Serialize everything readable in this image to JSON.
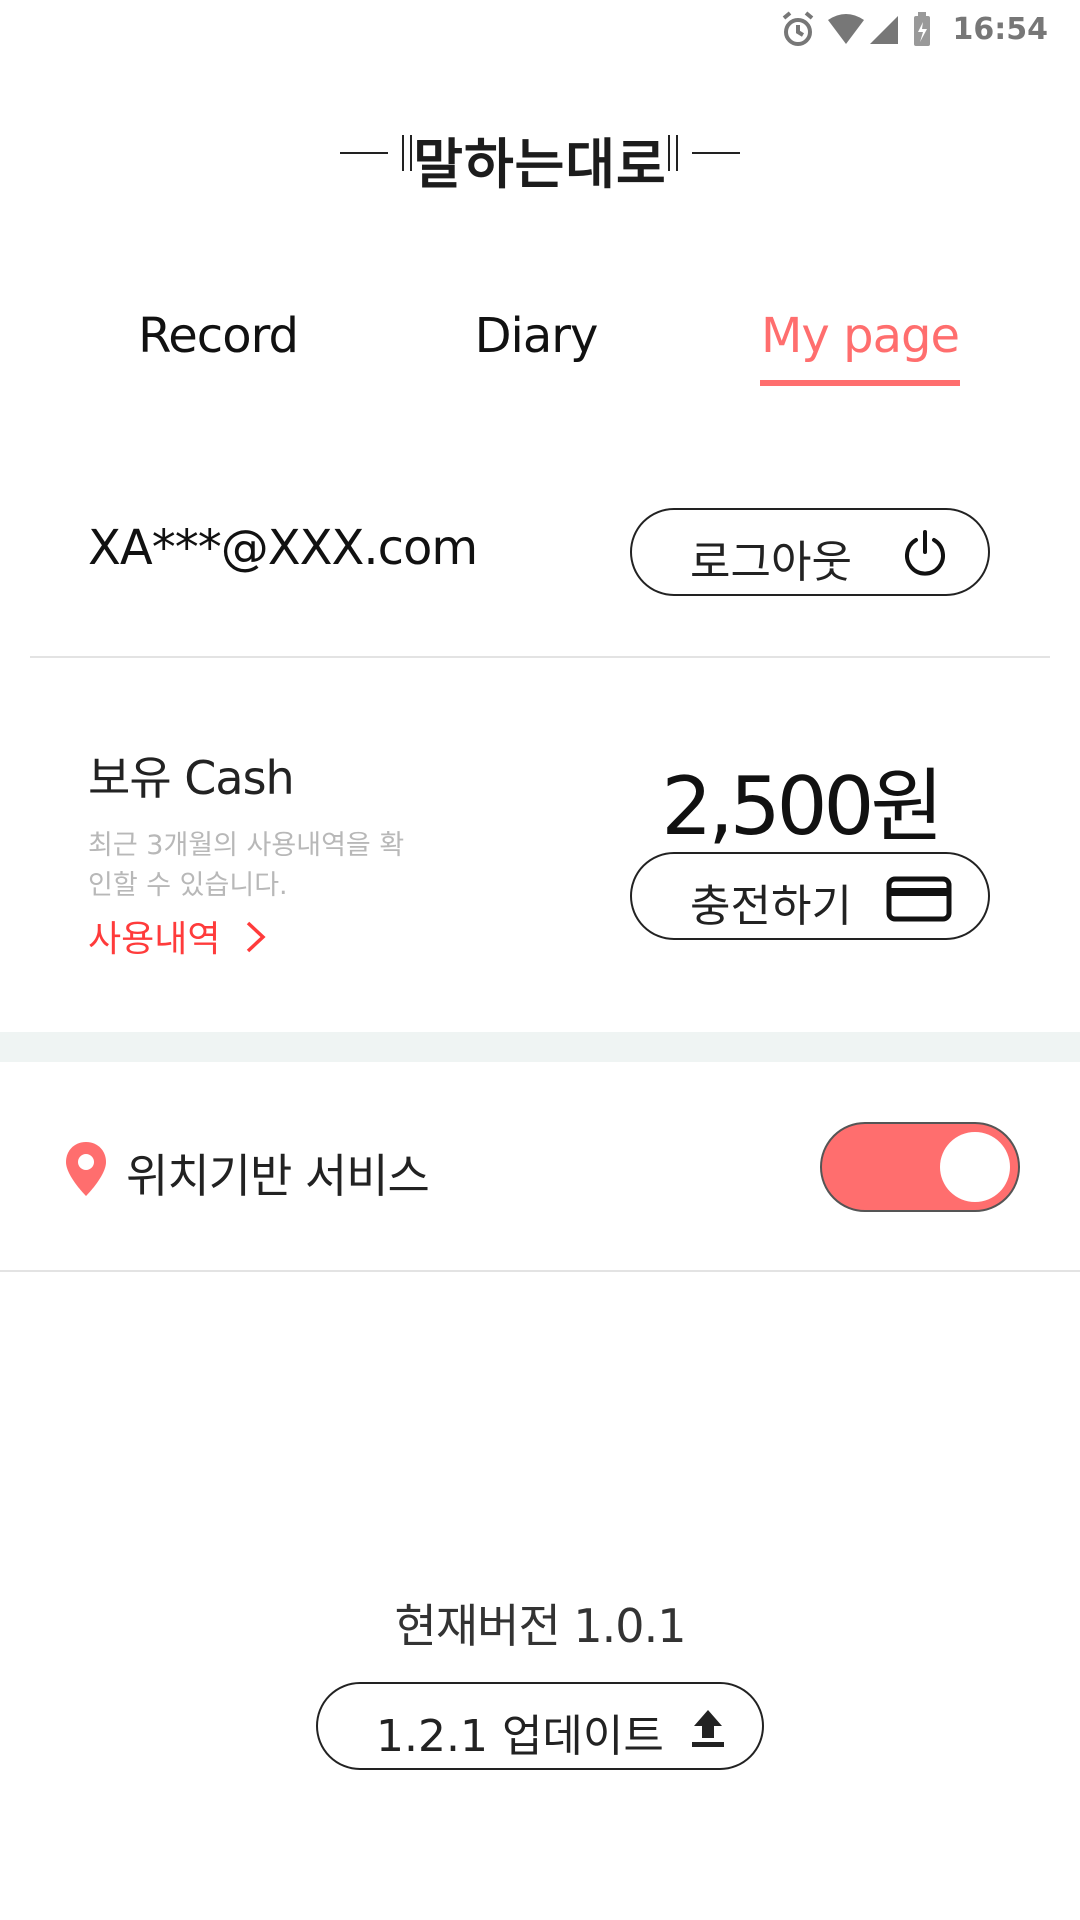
{
  "status_bar": {
    "time": "16:54",
    "icons": [
      "alarm-icon",
      "wifi-icon",
      "signal-icon",
      "battery-icon"
    ]
  },
  "header": {
    "title": "말하는대로"
  },
  "tabs": [
    {
      "label": "Record",
      "active": false
    },
    {
      "label": "Diary",
      "active": false
    },
    {
      "label": "My page",
      "active": true
    }
  ],
  "account": {
    "email": "XA***@XXX.com",
    "logout_label": "로그아웃",
    "logout_icon": "power-icon"
  },
  "cash": {
    "title": "보유 Cash",
    "description": "최근 3개월의 사용내역을 확인할 수 있습니다.",
    "history_link": "사용내역",
    "amount": "2,500원",
    "charge_label": "충전하기",
    "charge_icon": "credit-card-icon"
  },
  "location_service": {
    "label": "위치기반 서비스",
    "enabled": true,
    "icon": "location-pin-icon"
  },
  "version": {
    "current_label": "현재버전 1.0.1",
    "update_label": "1.2.1 업데이트",
    "update_icon": "upload-icon"
  },
  "colors": {
    "accent": "#ff6e6e",
    "link_red": "#ff3b3b",
    "band": "#eff4f3"
  }
}
